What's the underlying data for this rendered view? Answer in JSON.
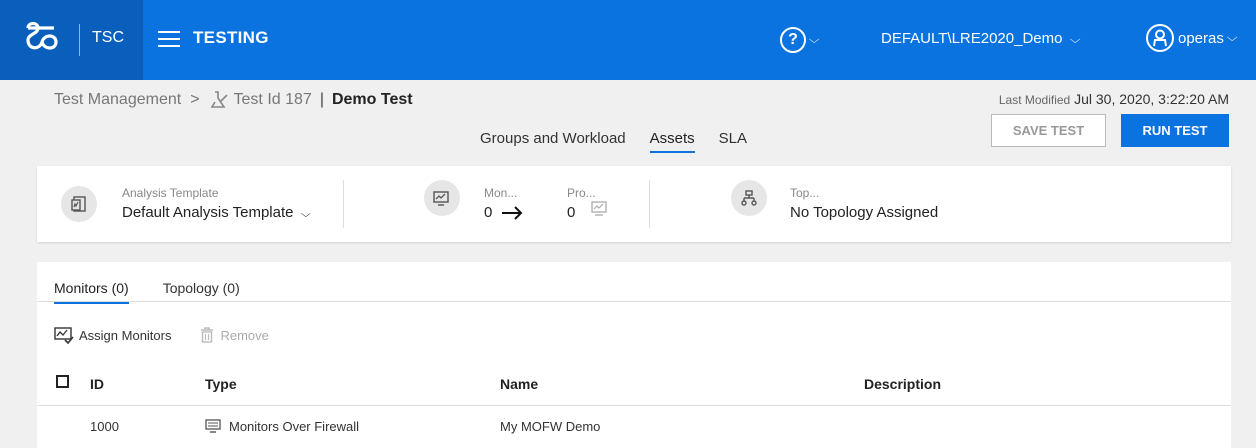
{
  "topbar": {
    "product": "TSC",
    "app_title": "TESTING",
    "help_icon": "question-circle-icon",
    "tenant": "DEFAULT\\LRE2020_Demo",
    "user": "operas",
    "colors": {
      "bar": "#0b73e0",
      "logo_bg": "#0a5fbd"
    }
  },
  "breadcrumb": {
    "root": "Test Management",
    "separator": ">",
    "test_id": "Test Id 187",
    "pipe": "|",
    "test_name": "Demo Test"
  },
  "last_modified": {
    "label": "Last Modified",
    "value": "Jul 30, 2020, 3:22:20 AM"
  },
  "tabs": [
    {
      "label": "Groups and Workload",
      "active": false
    },
    {
      "label": "Assets",
      "active": true
    },
    {
      "label": "SLA",
      "active": false
    }
  ],
  "buttons": {
    "save": "SAVE TEST",
    "run": "RUN TEST"
  },
  "assets": {
    "analysis_label": "Analysis Template",
    "analysis_value": "Default Analysis Template",
    "monitors_label": "Mon...",
    "monitors_value": "0",
    "profiles_label": "Pro...",
    "profiles_value": "0",
    "topology_label": "Top...",
    "topology_value": "No Topology Assigned"
  },
  "subtabs": [
    {
      "label": "Monitors (0)",
      "active": true
    },
    {
      "label": "Topology (0)",
      "active": false
    }
  ],
  "toolbar": {
    "assign": "Assign Monitors",
    "remove": "Remove"
  },
  "table": {
    "columns": [
      "ID",
      "Type",
      "Name",
      "Description"
    ],
    "rows": [
      {
        "id": "1000",
        "type": "Monitors Over Firewall",
        "name": "My MOFW Demo",
        "description": ""
      }
    ]
  }
}
